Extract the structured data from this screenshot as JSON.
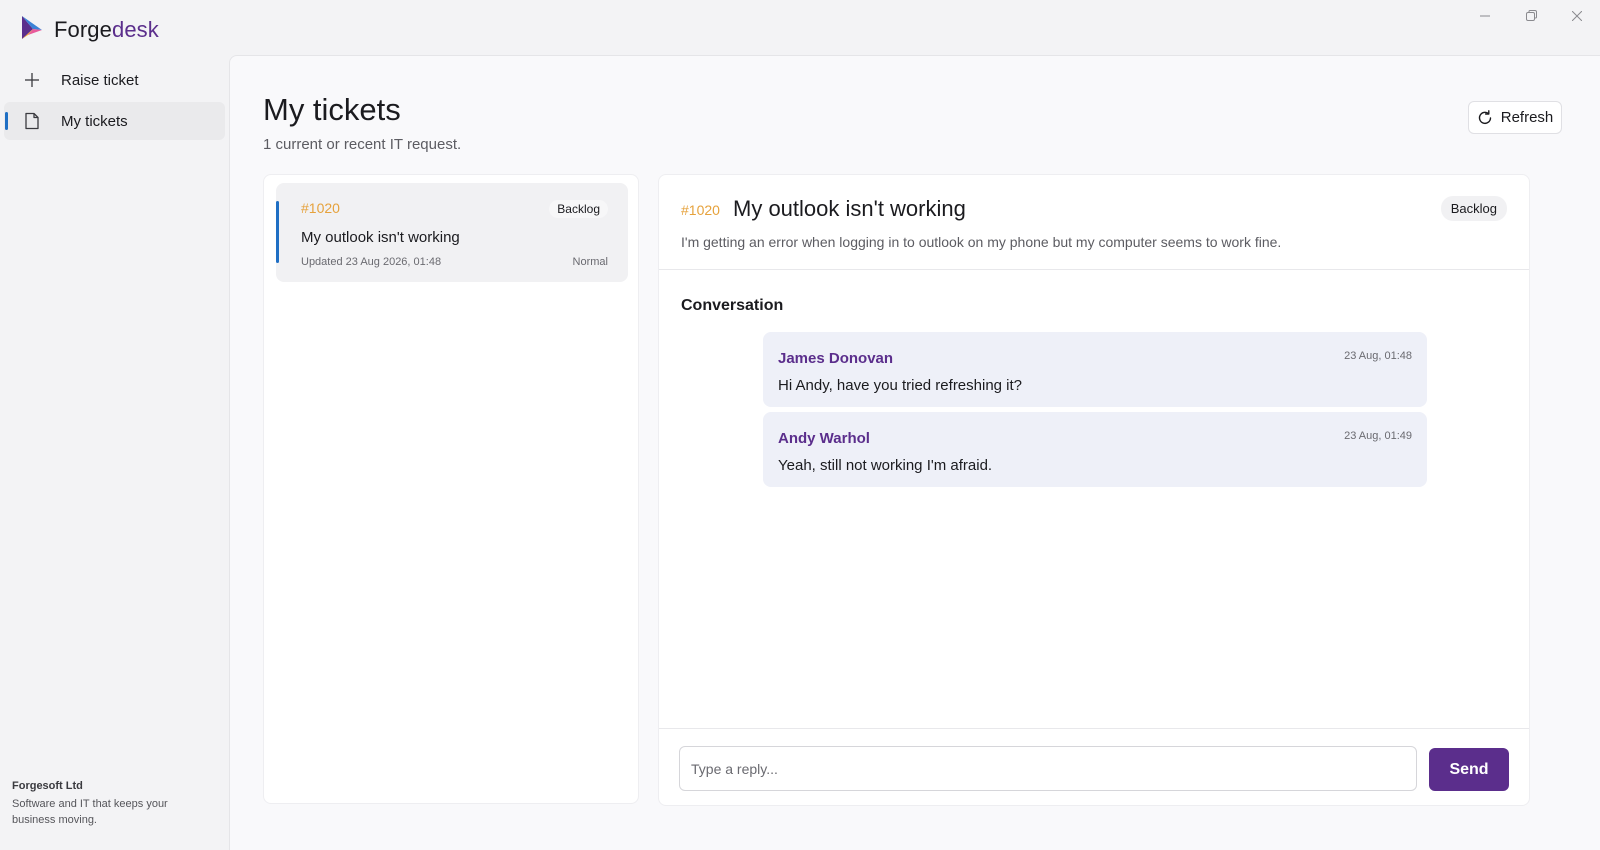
{
  "app": {
    "brand_part1": "Forge",
    "brand_part2": "desk",
    "logo_icon": "forgedesk-logo-icon",
    "window_controls": [
      "minimize-icon",
      "restore-icon",
      "close-icon"
    ]
  },
  "colors": {
    "accent": "#5b2e8c",
    "ticket_id": "#e6a23c",
    "active_indicator": "#1f6fc4"
  },
  "sidebar": {
    "items": [
      {
        "label": "Raise ticket",
        "icon": "plus-icon",
        "active": false
      },
      {
        "label": "My tickets",
        "icon": "document-icon",
        "active": true
      }
    ],
    "company_name": "Forgesoft Ltd",
    "company_tagline_line1": "Software and IT that keeps your",
    "company_tagline_line2": "business moving."
  },
  "page": {
    "title": "My tickets",
    "subtitle": "1 current or recent IT request.",
    "refresh_label": "Refresh",
    "refresh_icon": "refresh-icon"
  },
  "tickets": [
    {
      "id": "#1020",
      "status": "Backlog",
      "title": "My outlook isn't working",
      "updated": "Updated 23 Aug 2026, 01:48",
      "priority": "Normal"
    }
  ],
  "detail": {
    "id": "#1020",
    "title": "My outlook isn't working",
    "status": "Backlog",
    "description": "I'm getting an error when logging in to outlook on my phone but my computer seems to work fine.",
    "conversation_heading": "Conversation",
    "messages": [
      {
        "author": "James Donovan",
        "time": "23 Aug, 01:48",
        "body": "Hi Andy, have you tried refreshing it?"
      },
      {
        "author": "Andy Warhol",
        "time": "23 Aug, 01:49",
        "body": "Yeah, still not working I'm afraid."
      }
    ],
    "reply_placeholder": "Type a reply...",
    "reply_value": "",
    "send_label": "Send"
  }
}
